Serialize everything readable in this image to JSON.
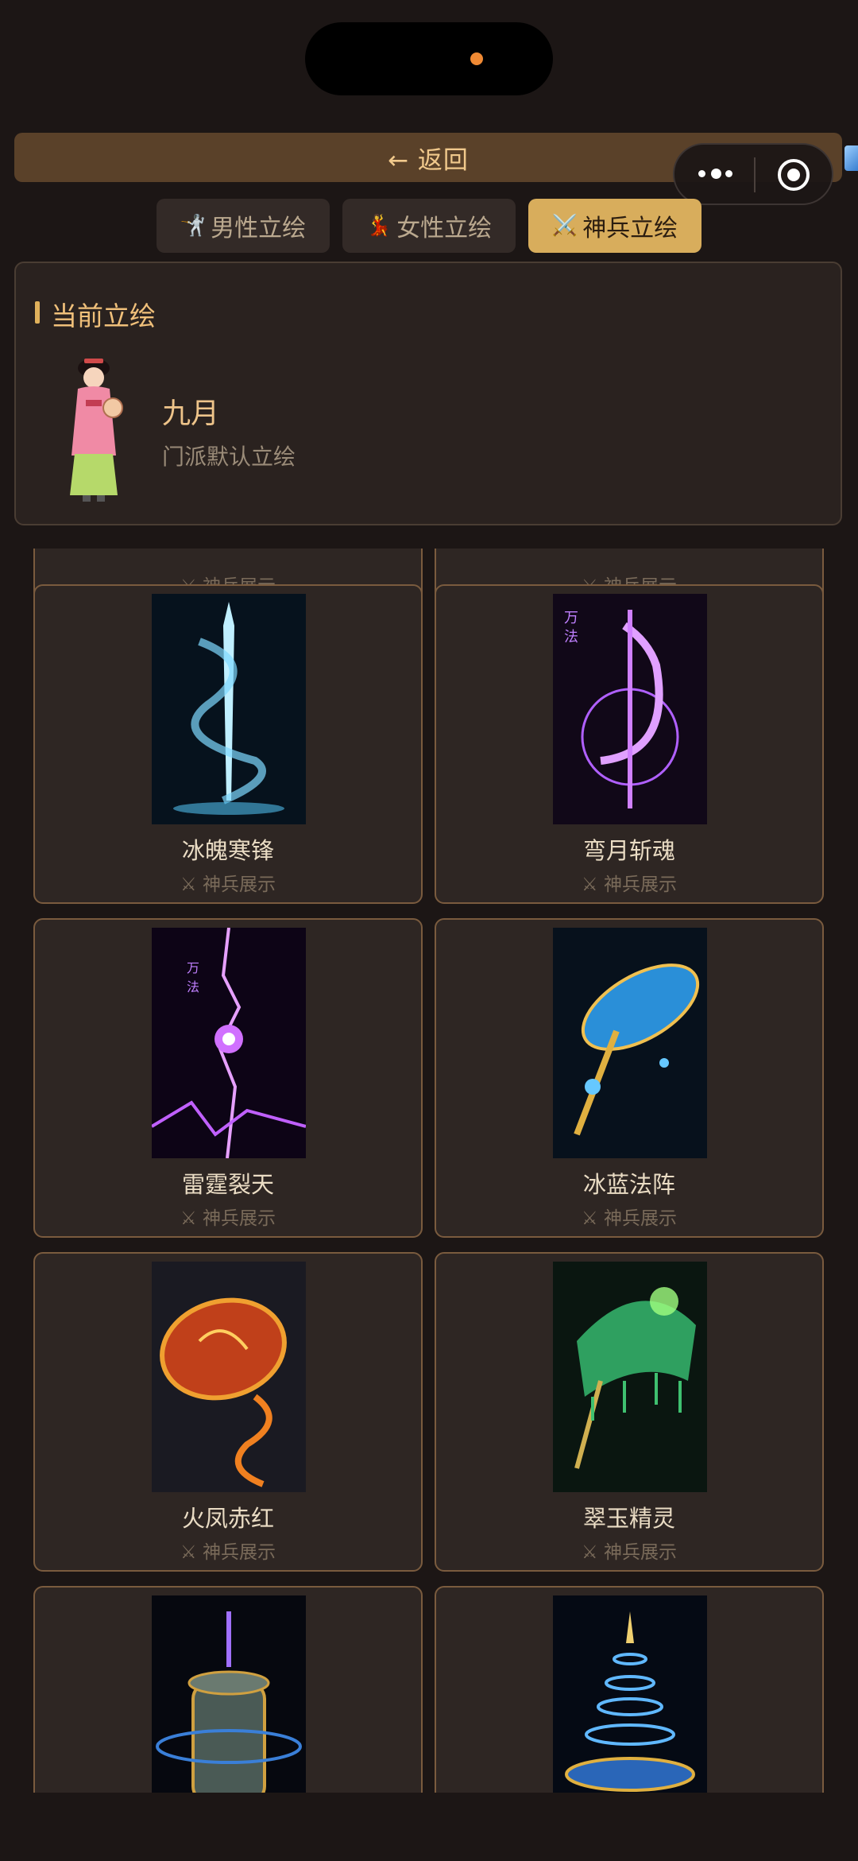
{
  "header": {
    "back_label": "← 返回"
  },
  "tabs": [
    {
      "icon": "🤺",
      "label": "男性立绘"
    },
    {
      "icon": "💃",
      "label": "女性立绘"
    },
    {
      "icon": "⚔️",
      "label": "神兵立绘"
    }
  ],
  "current": {
    "section_title": "当前立绘",
    "name": "九月",
    "description": "门派默认立绘"
  },
  "weapons": [
    {
      "name": "",
      "tag": "⚔ 神兵展示"
    },
    {
      "name": "",
      "tag": "⚔ 神兵展示"
    },
    {
      "name": "冰魄寒锋",
      "tag": "⚔ 神兵展示"
    },
    {
      "name": "弯月斩魂",
      "tag": "⚔ 神兵展示"
    },
    {
      "name": "雷霆裂天",
      "tag": "⚔ 神兵展示"
    },
    {
      "name": "冰蓝法阵",
      "tag": "⚔ 神兵展示"
    },
    {
      "name": "火凤赤红",
      "tag": "⚔ 神兵展示"
    },
    {
      "name": "翠玉精灵",
      "tag": "⚔ 神兵展示"
    },
    {
      "name": "",
      "tag": ""
    },
    {
      "name": "",
      "tag": ""
    }
  ],
  "colors": {
    "accent": "#d8ad5c",
    "card_border": "#7a5b3e",
    "background": "#1c1615"
  }
}
